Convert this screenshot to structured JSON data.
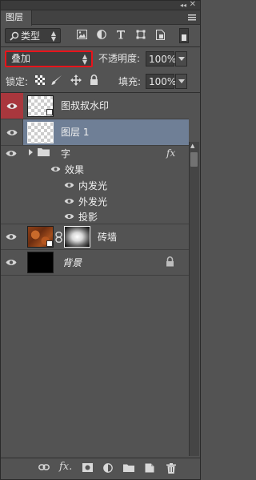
{
  "panel": {
    "tab_title": "图层",
    "collapse_glyph": "◂◂",
    "close_glyph": "✕"
  },
  "filter": {
    "kind_label": "类型",
    "icons": [
      "image-filter-icon",
      "adjustment-filter-icon",
      "text-filter-icon",
      "shape-filter-icon",
      "smart-object-filter-icon",
      "filter-toggle-icon"
    ]
  },
  "blend": {
    "mode": "叠加"
  },
  "opacity": {
    "label": "不透明度:",
    "value": "100%"
  },
  "lock": {
    "label": "锁定:",
    "icons": [
      "lock-transparent-pixels-icon",
      "lock-image-pixels-icon",
      "lock-position-icon",
      "lock-all-icon"
    ]
  },
  "fill": {
    "label": "填充:",
    "value": "100%"
  },
  "layers": [
    {
      "name": "图叔叔水印",
      "visible": true
    },
    {
      "name": "图层 1",
      "visible": true,
      "selected": true
    },
    {
      "name": "字",
      "visible": true,
      "fx": "fx",
      "effects_label": "效果",
      "effects": [
        "内发光",
        "外发光",
        "投影"
      ]
    },
    {
      "name": "砖墙",
      "visible": true
    },
    {
      "name": "背景",
      "visible": true,
      "locked": true
    }
  ],
  "colors": {
    "panel_bg": "#535353",
    "selected_row": "#6f7f96",
    "eye_highlight": "#a9373d",
    "blend_outline": "#e8141b"
  },
  "bottom_icons": [
    "link-layers-icon",
    "add-layer-style-icon",
    "add-mask-icon",
    "new-adjustment-layer-icon",
    "new-group-icon",
    "new-layer-icon",
    "delete-layer-icon"
  ]
}
